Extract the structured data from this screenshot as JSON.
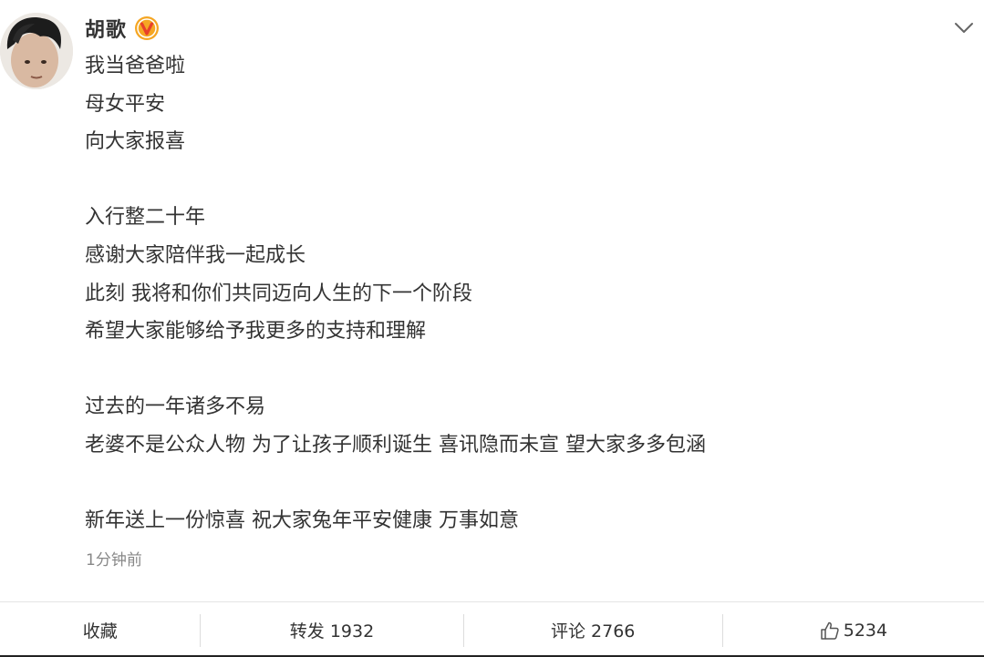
{
  "user": {
    "name": "胡歌",
    "avatar_icon": "user-avatar",
    "verified_icon": "verified-v-badge",
    "verified_color": "#f5a623"
  },
  "menu": {
    "icon": "chevron-down-icon"
  },
  "post": {
    "lines": [
      "我当爸爸啦",
      "母女平安",
      "向大家报喜",
      "",
      "入行整二十年",
      "感谢大家陪伴我一起成长",
      "此刻 我将和你们共同迈向人生的下一个阶段",
      "希望大家能够给予我更多的支持和理解",
      "",
      "过去的一年诸多不易",
      "老婆不是公众人物 为了让孩子顺利诞生 喜讯隐而未宣 望大家多多包涵",
      "",
      "新年送上一份惊喜 祝大家兔年平安健康 万事如意"
    ],
    "timestamp": "1分钟前"
  },
  "actions": {
    "favorite_label": "收藏",
    "repost_label": "转发 1932",
    "comment_label": "评论 2766",
    "like_count": "5234",
    "like_icon": "thumbs-up-icon"
  }
}
